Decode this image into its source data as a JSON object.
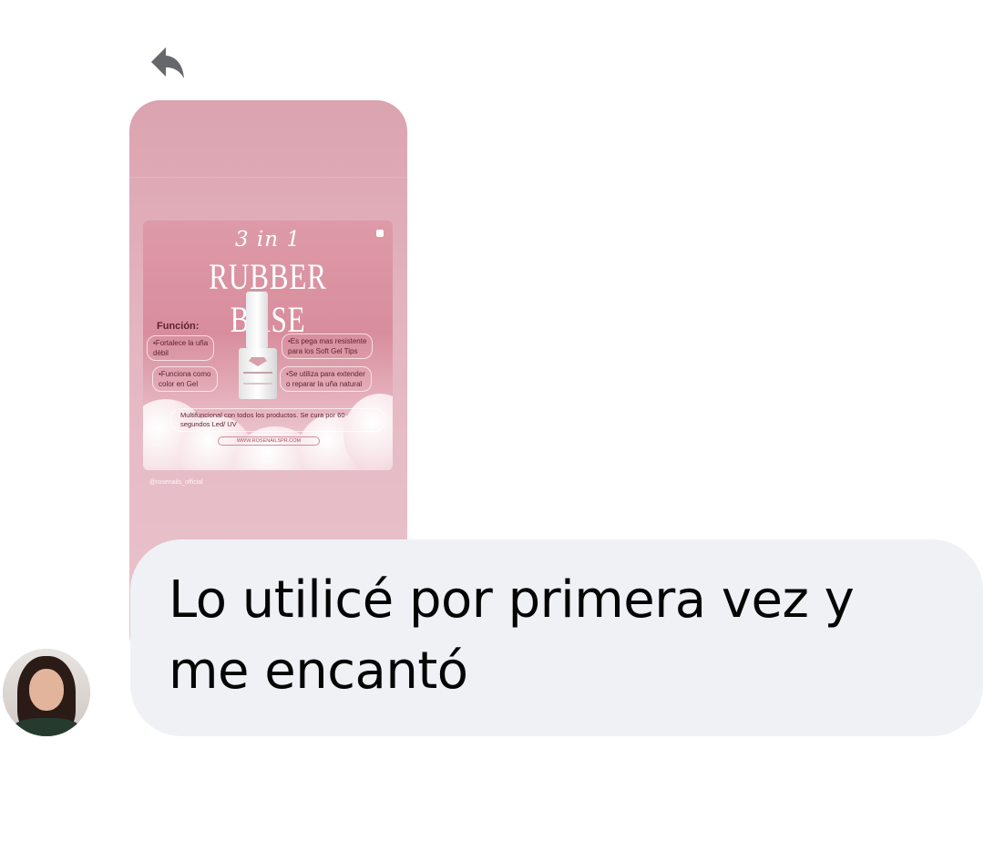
{
  "conversation": {
    "reply_icon": "reply-arrow-icon",
    "shared_post": {
      "promo": {
        "subtitle": "3 in 1",
        "headline": "RUBBER BASE",
        "section_title": "Función:",
        "bullets_left": [
          "•Fortalece la uña\ndèbil",
          "•Funciona como\ncolor en Gel"
        ],
        "bullets_right": [
          "•Es pega mas resistente\npara los Soft Gel Tips",
          "•Se utiliza para extender\no reparar la uña natural"
        ],
        "note": "Multifuncional con todos los productos. Se cura por 60 segundos Led/ UV",
        "url": "WWW.ROSENAILSPR.COM",
        "colors": {
          "card_bg": "#dba3b0",
          "promo_bg": "#de9aa8",
          "text_dark": "#5e2330"
        }
      },
      "handle": "@rosenails_official"
    },
    "message": {
      "text": "Lo utilicé por primera vez y me encantó",
      "bubble_color": "#f0f1f5"
    },
    "sender": {
      "avatar": "profile-photo"
    }
  }
}
